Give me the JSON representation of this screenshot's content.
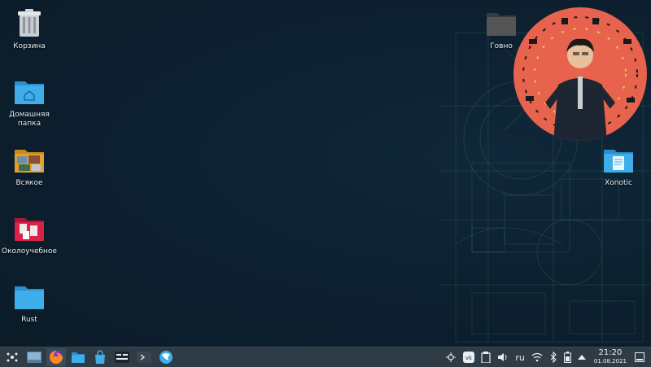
{
  "desktop": {
    "icons": [
      {
        "label": "Корзина",
        "icon": "trash-icon"
      },
      {
        "label": "Домашняя папка",
        "icon": "home-folder-icon"
      },
      {
        "label": "Всякое",
        "icon": "photo-folder-icon"
      },
      {
        "label": "Околоучебное",
        "icon": "notes-folder-icon"
      },
      {
        "label": "Rust",
        "icon": "folder-icon"
      },
      {
        "label": "Говно",
        "icon": "dark-folder-icon"
      },
      {
        "label": "Xonotic",
        "icon": "document-folder-icon"
      }
    ]
  },
  "taskbar": {
    "launchers": [
      {
        "name": "application-launcher",
        "icon": "kde-launcher-icon"
      },
      {
        "name": "show-desktop",
        "icon": "desktop-icon"
      },
      {
        "name": "firefox",
        "icon": "firefox-icon"
      },
      {
        "name": "file-manager",
        "icon": "dolphin-icon"
      },
      {
        "name": "software-store",
        "icon": "discover-icon"
      },
      {
        "name": "system-monitor",
        "icon": "monitor-icon"
      },
      {
        "name": "terminal",
        "icon": "terminal-icon"
      },
      {
        "name": "browser",
        "icon": "browser-icon"
      }
    ],
    "tray": {
      "keyboard_layout": "ru",
      "time": "21:20",
      "date": "01.08.2021"
    }
  },
  "colors": {
    "taskbar_bg": "#2f3b45",
    "folder_blue": "#3daee9",
    "accent_red": "#e8634d",
    "notes_red": "#d8224a"
  }
}
